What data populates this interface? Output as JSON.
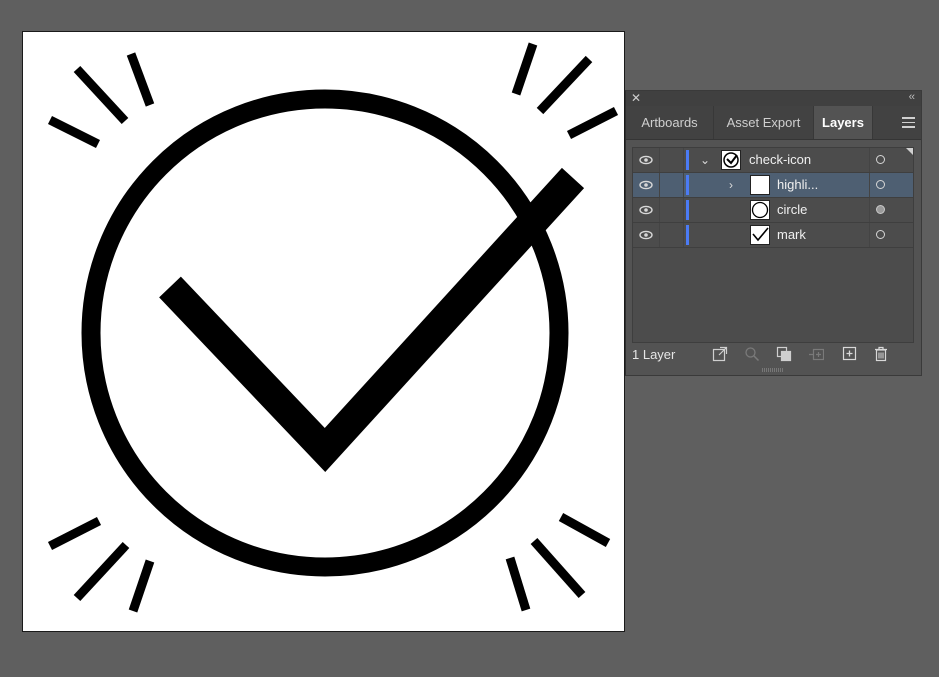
{
  "panel": {
    "close_glyph": "✕",
    "collapse_glyph": "‹‹",
    "tabs": [
      {
        "label": "Artboards"
      },
      {
        "label": "Asset Export"
      },
      {
        "label": "Layers"
      }
    ],
    "active_tab": "Layers",
    "menu_icon": "hamburger-menu-icon"
  },
  "layers": {
    "rows": [
      {
        "name": "check-icon",
        "expanded": true,
        "visible": true,
        "selected": false,
        "target_filled": false
      },
      {
        "name": "highli...",
        "expanded": false,
        "visible": true,
        "selected": true,
        "target_filled": false
      },
      {
        "name": "circle",
        "visible": true,
        "selected": false,
        "target_filled": true
      },
      {
        "name": "mark",
        "visible": true,
        "selected": false,
        "target_filled": false
      }
    ],
    "expand_glyph": "⌄",
    "collapsed_glyph": "›",
    "layer_color": "#4b7bf5"
  },
  "footer": {
    "count_label": "1 Layer",
    "icons": [
      "export-icon",
      "locate-object-icon",
      "make-clipping-mask-icon",
      "create-sublayer-icon",
      "new-layer-icon",
      "delete-icon"
    ]
  },
  "colors": {
    "workspace": "#5f5f5f",
    "artboard": "#ffffff",
    "selection_row": "#4e5f72"
  }
}
